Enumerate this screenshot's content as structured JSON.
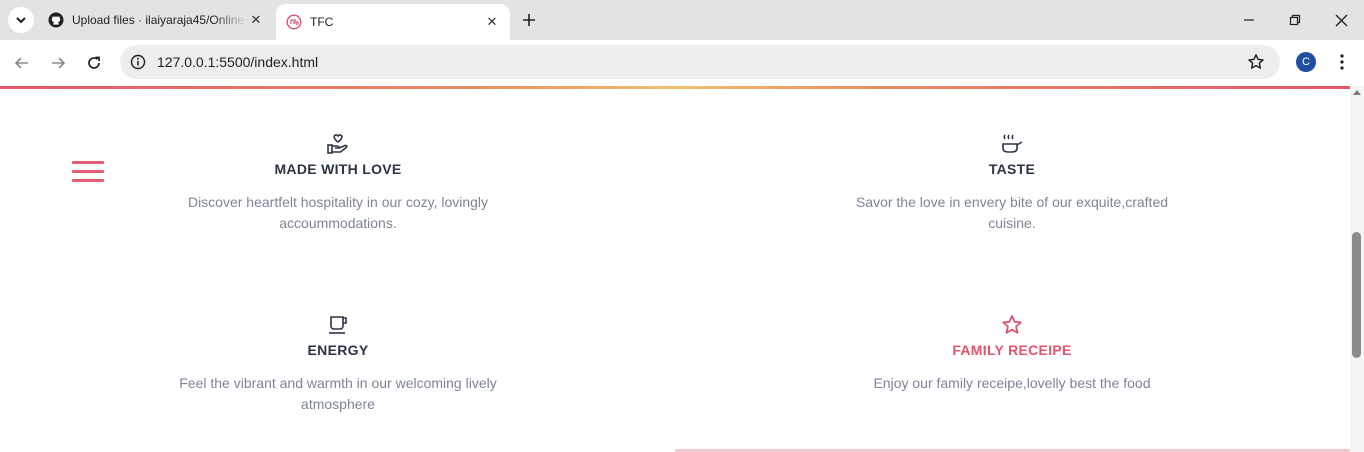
{
  "browser": {
    "tabs": [
      {
        "title": "Upload files · ilaiyaraja45/Online",
        "favicon": "github-icon",
        "active": false
      },
      {
        "title": "TFC",
        "favicon": "tfc-logo-icon",
        "active": true
      }
    ],
    "address": {
      "url": "127.0.0.1:5500/index.html"
    },
    "profile_initial": "C",
    "colors": {
      "tab_strip": "#e3e3e3",
      "omnibox": "#ededed",
      "profile": "#1f4fa2"
    }
  },
  "page": {
    "menu_icon": "hamburger-menu-icon",
    "accent_color": "#e05470",
    "features": [
      {
        "icon": "hand-heart-icon",
        "title": "MADE WITH LOVE",
        "text": "Discover heartfelt hospitality in our cozy, lovingly accoummodations."
      },
      {
        "icon": "cooking-pot-icon",
        "title": "TASTE",
        "text": "Savor the love in envery bite of our exquite,crafted cuisine."
      },
      {
        "icon": "coffee-cup-icon",
        "title": "ENERGY",
        "text": "Feel the vibrant and warmth in our welcoming lively atmosphere"
      },
      {
        "icon": "star-icon",
        "title": "FAMILY RECEIPE",
        "text": "Enjoy our family receipe,lovelly best the food"
      }
    ]
  }
}
